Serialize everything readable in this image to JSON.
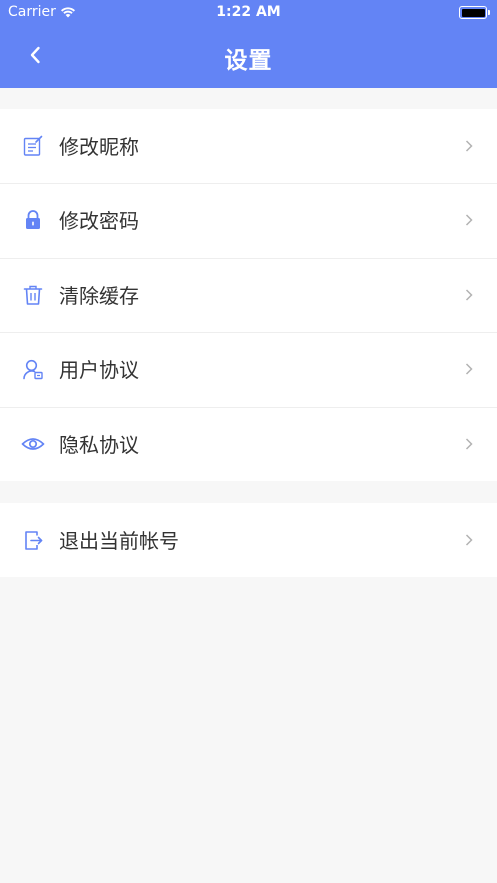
{
  "status_bar": {
    "carrier": "Carrier",
    "time": "1:22 AM"
  },
  "nav": {
    "title": "设置"
  },
  "settings": {
    "items": [
      {
        "label": "修改昵称",
        "icon": "edit-note-icon"
      },
      {
        "label": "修改密码",
        "icon": "lock-icon"
      },
      {
        "label": "清除缓存",
        "icon": "trash-icon"
      },
      {
        "label": "用户协议",
        "icon": "user-agreement-icon"
      },
      {
        "label": "隐私协议",
        "icon": "eye-icon"
      }
    ],
    "logout": {
      "label": "退出当前帐号",
      "icon": "logout-icon"
    }
  },
  "colors": {
    "accent": "#6384f5",
    "background": "#f7f7f7",
    "text": "#333333",
    "chevron": "#b3b3b3"
  }
}
